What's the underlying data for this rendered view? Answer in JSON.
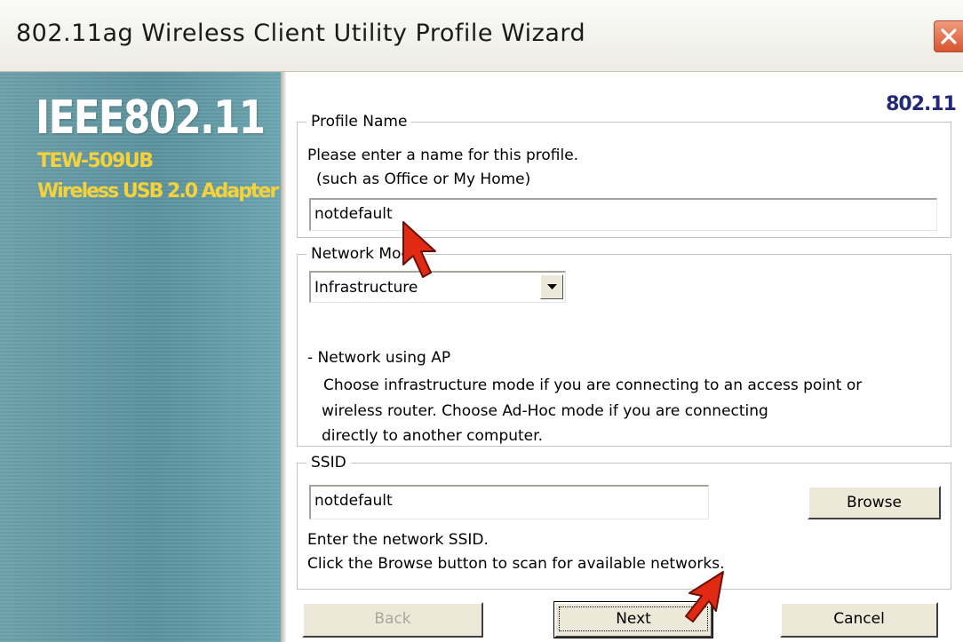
{
  "window": {
    "title": "802.11ag Wireless Client Utility Profile Wizard"
  },
  "sidebar": {
    "logo_text": "IEEE802.11",
    "model": "TEW-509UB",
    "adapter": "Wireless USB 2.0 Adapter"
  },
  "brand": "802.11",
  "profile_name": {
    "legend": "Profile Name",
    "instruction_1": "Please enter a name for this profile.",
    "instruction_2": "(such as Office or My Home)",
    "value": "notdefault"
  },
  "network_mode": {
    "legend": "Network Mode",
    "selected": "Infrastructure",
    "desc_title": "- Network using AP",
    "desc_1": "Choose infrastructure mode if you are connecting to an access point or",
    "desc_2": "wireless router. Choose Ad-Hoc mode if you are connecting",
    "desc_3": "directly to another computer."
  },
  "ssid": {
    "legend": "SSID",
    "value": "notdefault",
    "browse_label": "Browse",
    "help_1": "Enter the network SSID.",
    "help_2": "Click the Browse button to scan for available networks."
  },
  "footer": {
    "back_label": "Back",
    "next_label": "Next",
    "cancel_label": "Cancel"
  },
  "colors": {
    "accent_red_arrow": "#e02a14",
    "sidebar_teal": "#5f96a1",
    "brand_navy": "#22287a",
    "model_yellow": "#f5d23a"
  }
}
